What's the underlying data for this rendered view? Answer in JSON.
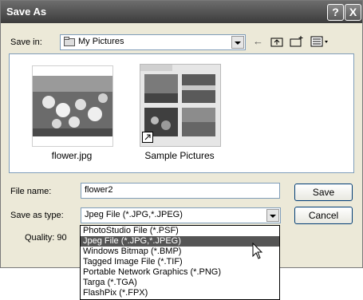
{
  "window": {
    "title": "Save As"
  },
  "title_buttons": {
    "help": "?",
    "close": "X"
  },
  "save_in": {
    "label": "Save in:",
    "value": "My Pictures"
  },
  "files": [
    {
      "name": "flower.jpg"
    },
    {
      "name": "Sample Pictures"
    }
  ],
  "file_name": {
    "label": "File name:",
    "value": "flower2"
  },
  "save_as_type": {
    "label": "Save as type:",
    "value": "Jpeg File (*.JPG,*.JPEG)",
    "options": [
      "PhotoStudio File (*.PSF)",
      "Jpeg File (*.JPG,*.JPEG)",
      "Windows Bitmap (*.BMP)",
      "Tagged Image File (*.TIF)",
      "Portable Network Graphics (*.PNG)",
      "Targa (*.TGA)",
      "FlashPix (*.FPX)"
    ],
    "selected_index": 1
  },
  "quality": {
    "label": "Quality: 90"
  },
  "buttons": {
    "save": "Save",
    "cancel": "Cancel"
  },
  "icons": [
    "help-icon",
    "close-icon",
    "folder-icon",
    "back-arrow-icon",
    "up-folder-icon",
    "new-folder-icon",
    "views-menu-icon",
    "shortcut-icon",
    "pointer-cursor-icon"
  ]
}
